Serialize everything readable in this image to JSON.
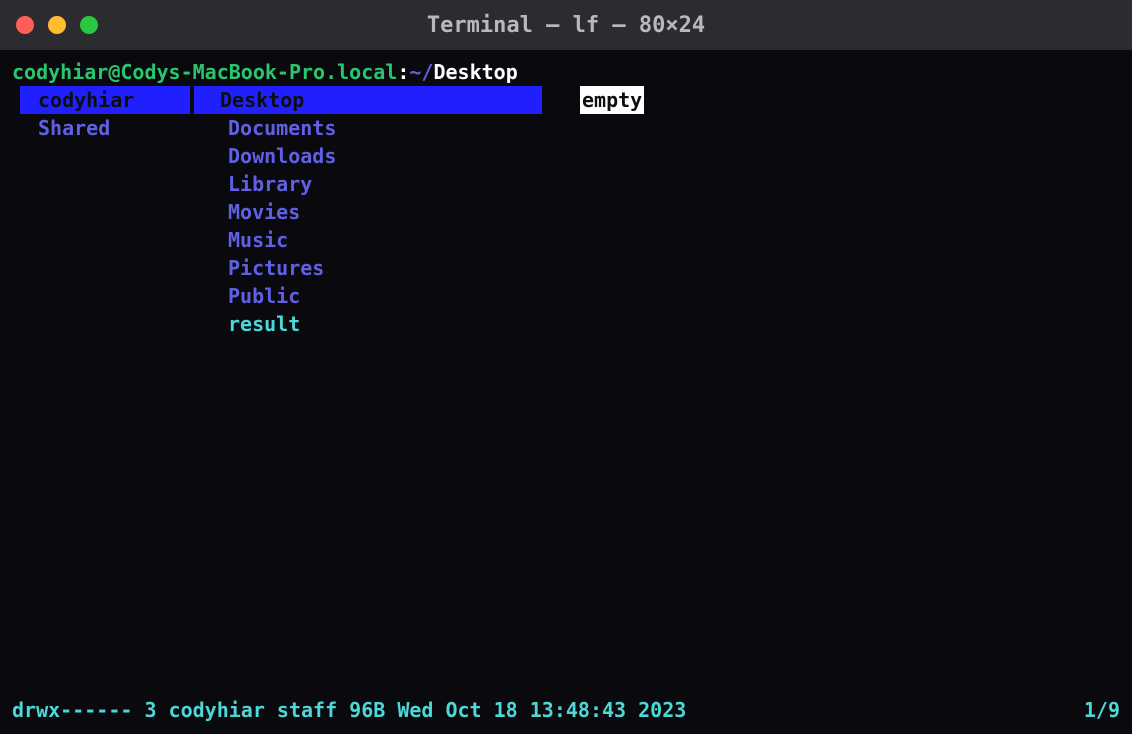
{
  "titlebar": {
    "title": "Terminal — lf — 80×24"
  },
  "prompt": {
    "user_host": "codyhiar@Codys-MacBook-Pro.local",
    "colon": ":",
    "tilde": "~/",
    "path": "Desktop"
  },
  "columns": {
    "parent": [
      {
        "name": "codyhiar",
        "type": "dir",
        "selected": true
      },
      {
        "name": "Shared",
        "type": "dir",
        "selected": false
      }
    ],
    "current": [
      {
        "name": "Desktop",
        "type": "dir",
        "selected": true
      },
      {
        "name": "Documents",
        "type": "dir",
        "selected": false
      },
      {
        "name": "Downloads",
        "type": "dir",
        "selected": false
      },
      {
        "name": "Library",
        "type": "dir",
        "selected": false
      },
      {
        "name": "Movies",
        "type": "dir",
        "selected": false
      },
      {
        "name": "Music",
        "type": "dir",
        "selected": false
      },
      {
        "name": "Pictures",
        "type": "dir",
        "selected": false
      },
      {
        "name": "Public",
        "type": "dir",
        "selected": false
      },
      {
        "name": "result",
        "type": "file",
        "selected": false
      }
    ],
    "preview": {
      "empty_label": "empty"
    }
  },
  "status": {
    "left": "drwx------ 3 codyhiar staff  96B Wed Oct 18 13:48:43 2023",
    "right": "1/9"
  }
}
